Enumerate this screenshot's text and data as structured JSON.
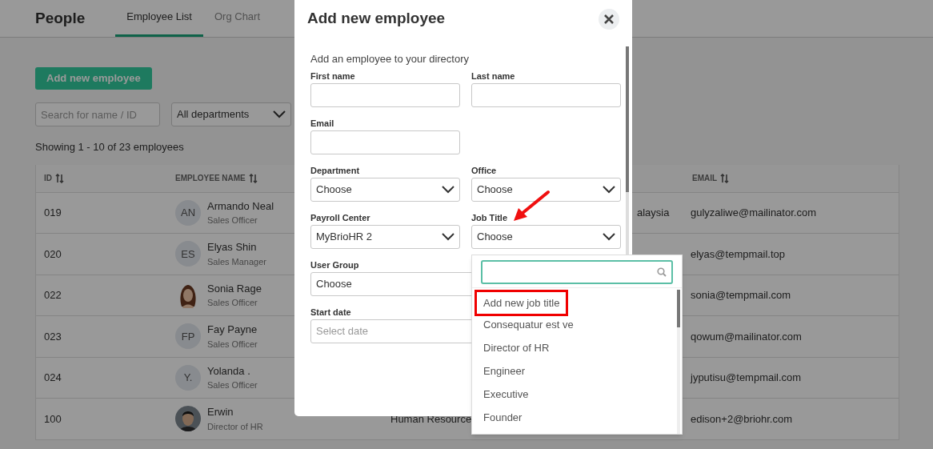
{
  "header": {
    "title": "People",
    "tabs": [
      {
        "label": "Employee List",
        "selected": true
      },
      {
        "label": "Org Chart",
        "selected": false
      }
    ]
  },
  "add_button": "Add new employee",
  "search": {
    "placeholder": "Search for name / ID"
  },
  "department_filter": {
    "value": "All departments"
  },
  "summary": "Showing 1 - 10 of 23 employees",
  "table": {
    "columns": [
      "ID",
      "EMPLOYEE NAME",
      "EMAIL"
    ],
    "rows": [
      {
        "id": "019",
        "avatar": {
          "kind": "initials",
          "text": "AN"
        },
        "name": "Armando Neal",
        "role": "Sales Officer",
        "column_4": "alaysia",
        "email": "gulyzaliwe@mailinator.com"
      },
      {
        "id": "020",
        "avatar": {
          "kind": "initials",
          "text": "ES"
        },
        "name": "Elyas Shin",
        "role": "Sales Manager",
        "email": "elyas@tempmail.top"
      },
      {
        "id": "022",
        "avatar": {
          "kind": "cartoon"
        },
        "name": "Sonia Rage",
        "role": "Sales Officer",
        "email": "sonia@tempmail.com"
      },
      {
        "id": "023",
        "avatar": {
          "kind": "initials",
          "text": "FP"
        },
        "name": "Fay Payne",
        "role": "Sales Officer",
        "email": "qowum@mailinator.com"
      },
      {
        "id": "024",
        "avatar": {
          "kind": "initials",
          "text": "Y."
        },
        "name": "Yolanda .",
        "role": "Sales Officer",
        "email": "jyputisu@tempmail.com"
      },
      {
        "id": "100",
        "name": "Erwin",
        "role": "Director of HR",
        "column_3": "Human Resource",
        "email": "edison+2@briohr.com"
      }
    ]
  },
  "modal": {
    "title": "Add new employee",
    "subtitle": "Add an employee to your directory",
    "rows": [
      [
        {
          "kind": "text",
          "label": "First name"
        },
        {
          "kind": "text",
          "label": "Last name"
        }
      ],
      [
        {
          "kind": "text",
          "label": "Email"
        }
      ],
      [
        {
          "kind": "select",
          "label": "Department",
          "value": "Choose"
        },
        {
          "kind": "select",
          "label": "Office",
          "value": "Choose"
        }
      ],
      [
        {
          "kind": "select",
          "label": "Payroll Center",
          "value": "MyBrioHR 2"
        },
        {
          "kind": "select",
          "label": "Job Title",
          "value": "Choose"
        }
      ],
      [
        {
          "kind": "select",
          "label": "User Group",
          "value": "Choose",
          "full_width": true
        }
      ],
      [
        {
          "kind": "text",
          "label": "Start date",
          "placeholder": "Select date",
          "full_width": true
        }
      ]
    ]
  },
  "dropdown": {
    "options": [
      {
        "label": "Add new job title",
        "highlighted": true
      },
      {
        "label": "Consequatur est ve",
        "highlighted": false
      },
      {
        "label": "Director of HR",
        "highlighted": false
      },
      {
        "label": "Engineer",
        "highlighted": false
      },
      {
        "label": "Executive",
        "highlighted": false
      },
      {
        "label": "Founder",
        "highlighted": false
      }
    ]
  }
}
